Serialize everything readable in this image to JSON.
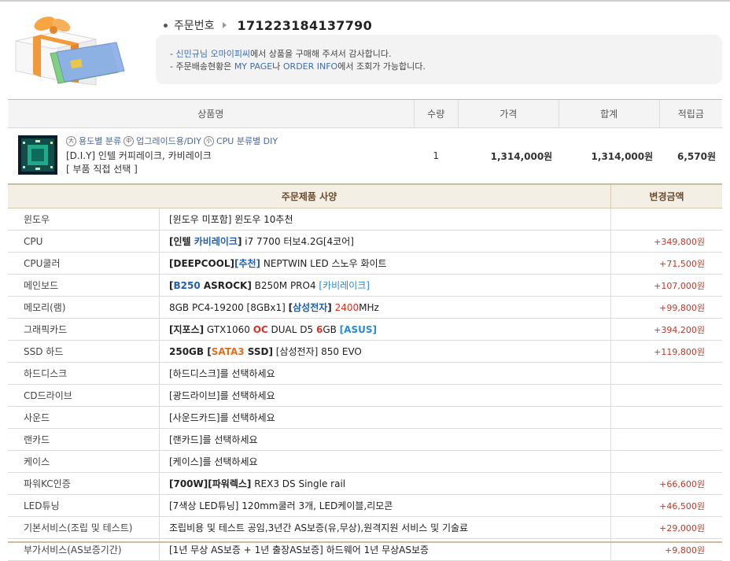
{
  "order": {
    "label": "주문번호",
    "number": "171223184137790"
  },
  "notice": {
    "line1": {
      "pre": "- ",
      "name": "신민규님",
      "space": " ",
      "shop": "오마이피씨",
      "post": "에서 상품을 구매해 주셔서 감사합니다."
    },
    "line2": {
      "pre": "- 주문배송현황은 ",
      "link1": "MY PAGE",
      "mid": "나 ",
      "link2": "ORDER INFO",
      "post": "에서 조회가 가능합니다."
    }
  },
  "product_table": {
    "headers": [
      "상품명",
      "수량",
      "가격",
      "합계",
      "적립금"
    ],
    "row": {
      "category": {
        "badge1": "大",
        "cat1": "용도별 분류",
        "badge2": "中",
        "cat2": "업그레이드용/DIY",
        "badge3": "小",
        "cat3": "CPU 분류별 DIY"
      },
      "name": "[D.I.Y] 인텔 커피레이크, 카비레이크",
      "option": "[ 부품 직접 선택 ]",
      "qty": "1",
      "price": "1,314,000원",
      "total": "1,314,000원",
      "points": "6,570원"
    }
  },
  "spec_table": {
    "header_spec": "주문제품 사양",
    "header_change": "변경금액",
    "rows": [
      {
        "label": "윈도우",
        "change": ""
      },
      {
        "label": "CPU",
        "change": "+349,800원"
      },
      {
        "label": "CPU쿨러",
        "change": "+71,500원"
      },
      {
        "label": "메인보드",
        "change": "+107,000원"
      },
      {
        "label": "메모리(램)",
        "change": "+99,800원"
      },
      {
        "label": "그래픽카드",
        "change": "+394,200원"
      },
      {
        "label": "SSD 하드",
        "change": "+119,800원"
      },
      {
        "label": "하드디스크",
        "change": ""
      },
      {
        "label": "CD드라이브",
        "change": ""
      },
      {
        "label": "사운드",
        "change": ""
      },
      {
        "label": "랜카드",
        "change": ""
      },
      {
        "label": "케이스",
        "change": ""
      },
      {
        "label": "파워KC인증",
        "change": "+66,600원"
      },
      {
        "label": "LED튜닝",
        "change": "+46,500원"
      },
      {
        "label": "기본서비스(조립 및 테스트)",
        "change": "+29,000원"
      },
      {
        "label": "부가서비스(AS보증기간)",
        "change": "+9,800원"
      }
    ],
    "values": {
      "win": {
        "t": "[윈도우 미포함] 윈도우 10추천"
      },
      "cpu": {
        "a": "[인텔 ",
        "b": "카비레이크",
        "c": "]",
        "d": " i7 7700 터보4.2G[4코어]"
      },
      "cooler": {
        "a": "[DEEPCOOL]",
        "b": "[추천]",
        "c": " NEPTWIN LED 스노우 화이트"
      },
      "mb": {
        "a": "[",
        "b": "B250",
        "c": " ASROCK]",
        "d": " B250M PRO4 ",
        "e": "[카비레이크]"
      },
      "mem": {
        "a": "8GB PC4-19200 [8GBx1] ",
        "b": "[",
        "c": "삼성전자",
        "d": "]",
        "e": " ",
        "f": "2400",
        "g": "MHz"
      },
      "gpu": {
        "a": "[지포스]",
        "b": " GTX1060 ",
        "c": "OC",
        "d": " DUAL D5 ",
        "e": "6",
        "f": "GB ",
        "g": "[ASUS]"
      },
      "ssd": {
        "a": "250GB [",
        "b": "SATA3",
        "c": " SSD]",
        "d": " [삼성전자] 850 EVO"
      },
      "hdd": {
        "t": "[하드디스크]를 선택하세요"
      },
      "cd": {
        "t": "[광드라이브]를 선택하세요"
      },
      "sound": {
        "t": "[사운드카드]를 선택하세요"
      },
      "lan": {
        "t": "[랜카드]를 선택하세요"
      },
      "case": {
        "t": "[케이스]를 선택하세요"
      },
      "psu": {
        "a": "[700W][파워렉스]",
        "b": " REX3 DS Single rail"
      },
      "led": {
        "t": "[7색상 LED튜닝] 120mm쿨러 3개, LED케이블,리모콘"
      },
      "basic": {
        "t": "조립비용 및 테스트 공임,3년간 AS보증(유,무상),원격지원 서비스 및 기술료"
      },
      "extra": {
        "t": "[1년 무상 AS보증 + 1년 출장AS보증] 하드웨어 1년 무상AS보증"
      }
    }
  },
  "icons": {
    "gift": "gift-box-with-cards-icon",
    "thumb": "cpu-chip-product-icon",
    "arrow": "arrow-right-icon"
  },
  "colors": {
    "accent_blue": "#2060b0",
    "price_red": "#c0392b",
    "spec_header_bg": "#f4efe4"
  }
}
